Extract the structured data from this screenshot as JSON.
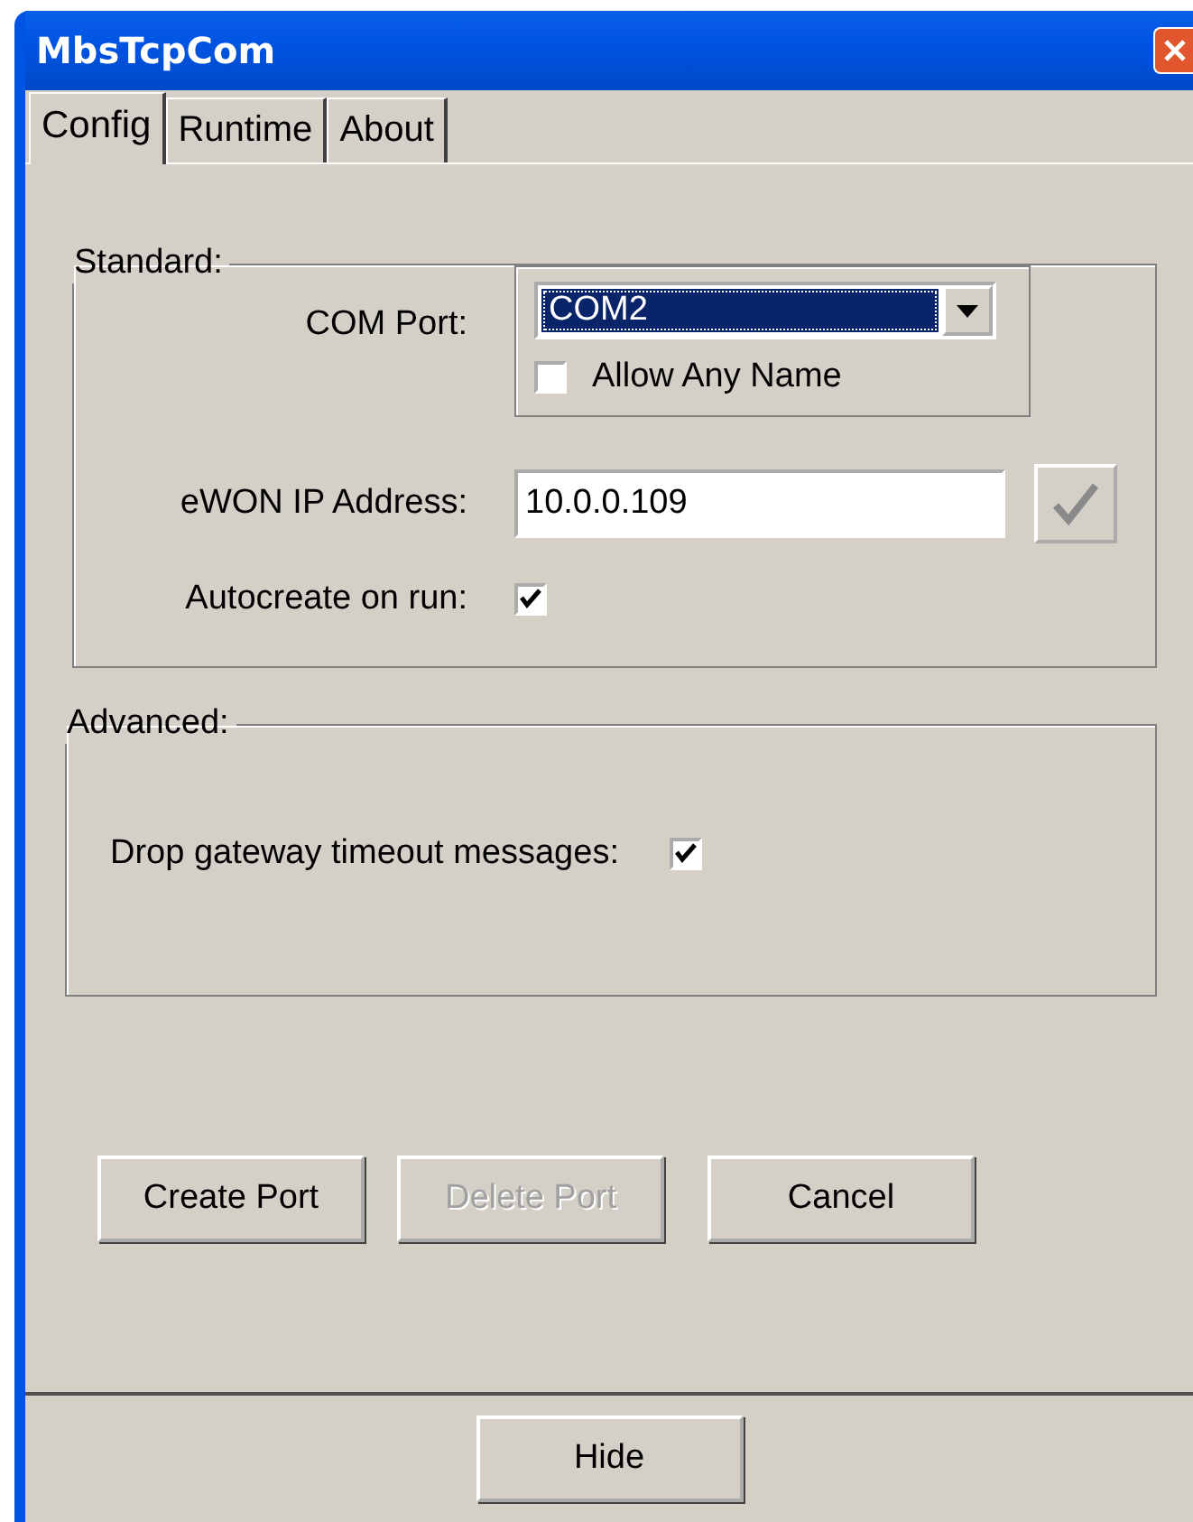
{
  "window": {
    "title": "MbsTcpCom"
  },
  "tabs": [
    {
      "label": "Config",
      "selected": true
    },
    {
      "label": "Runtime",
      "selected": false
    },
    {
      "label": "About",
      "selected": false
    }
  ],
  "standard": {
    "title": "Standard:",
    "com_port_label": "COM Port:",
    "com_port_value": "COM2",
    "allow_any_name": {
      "label": "Allow Any Name",
      "checked": false
    },
    "ip_label": "eWON IP Address:",
    "ip_value": "10.0.0.109",
    "autocreate": {
      "label": "Autocreate on run:",
      "checked": true
    }
  },
  "advanced": {
    "title": "Advanced:",
    "drop_timeout": {
      "label": "Drop gateway timeout messages:",
      "checked": true
    }
  },
  "buttons": [
    {
      "label": "Create Port",
      "disabled": false
    },
    {
      "label": "Delete Port",
      "disabled": true
    },
    {
      "label": "Cancel",
      "disabled": false
    }
  ],
  "footer_button": "Hide"
}
